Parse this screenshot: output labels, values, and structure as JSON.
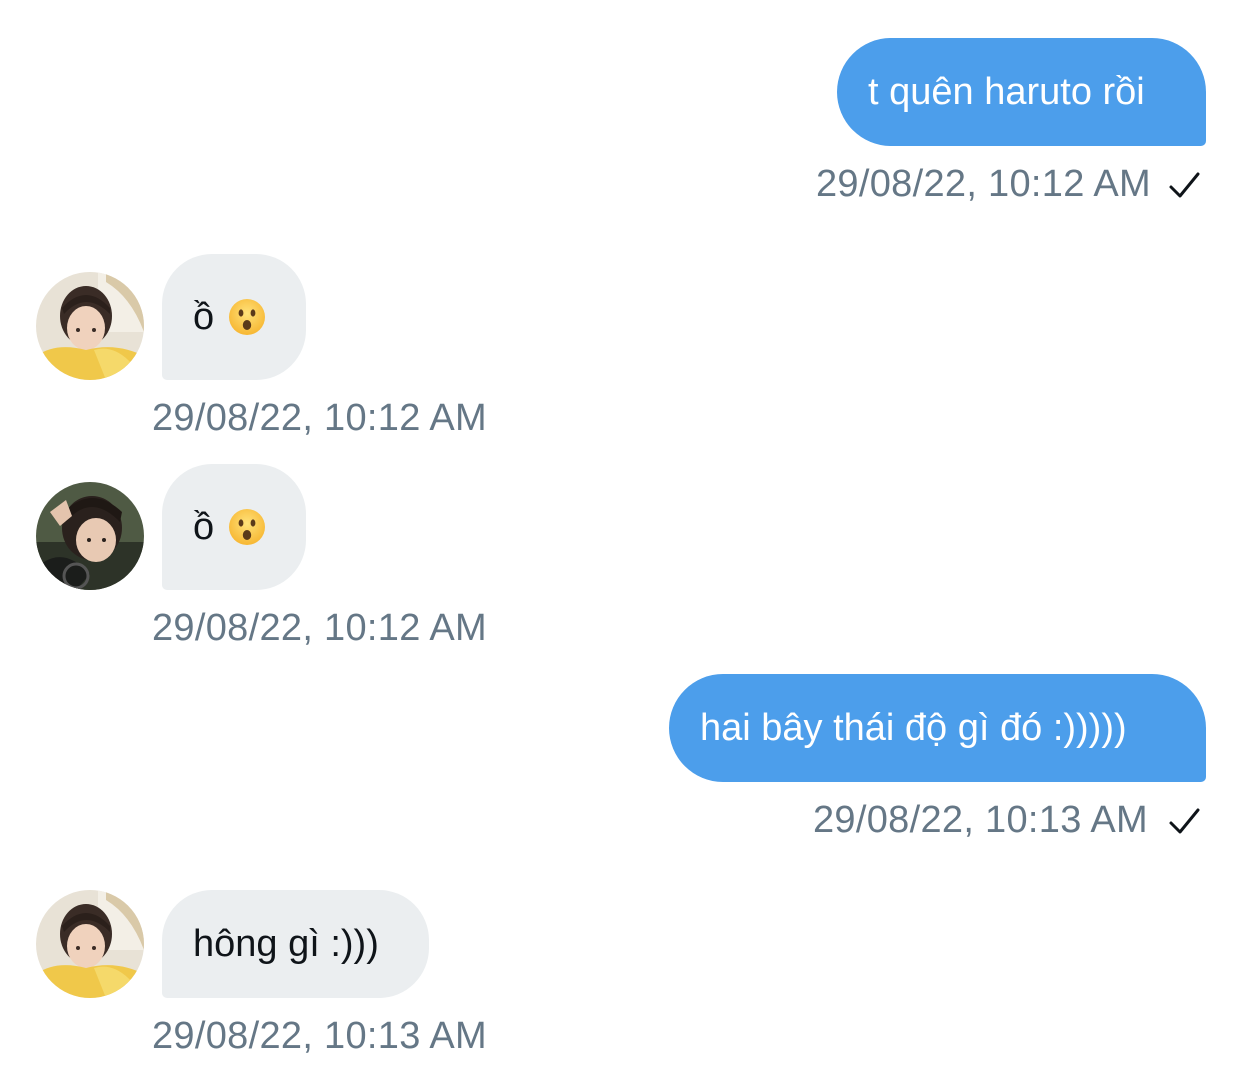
{
  "messages": [
    {
      "direction": "out",
      "text": "t quên haruto rồi",
      "timestamp": "29/08/22, 10:12 AM",
      "status": "✓"
    },
    {
      "direction": "in",
      "text": "ồ",
      "emoji": "hushed-face",
      "timestamp": "29/08/22, 10:12 AM",
      "avatar": "avatar-user-1"
    },
    {
      "direction": "in",
      "text": "ồ",
      "emoji": "hushed-face",
      "timestamp": "29/08/22, 10:12 AM",
      "avatar": "avatar-user-2"
    },
    {
      "direction": "out",
      "text": "hai bây thái độ gì đó :)))))",
      "timestamp": "29/08/22, 10:13 AM",
      "status": "✓"
    },
    {
      "direction": "in",
      "text": "hông gì :)))",
      "timestamp": "29/08/22, 10:13 AM",
      "avatar": "avatar-user-1"
    }
  ],
  "colors": {
    "outgoing_bubble": "#4c9eeb",
    "incoming_bubble": "#ebeef0",
    "timestamp": "#657786"
  }
}
